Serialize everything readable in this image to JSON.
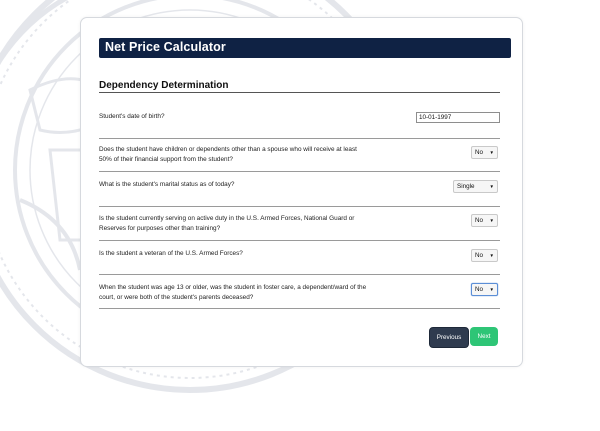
{
  "app": {
    "title": "Net Price Calculator"
  },
  "section": {
    "title": "Dependency Determination"
  },
  "questions": [
    {
      "text": "Student's date of birth?",
      "control": "text",
      "value": "10-01-1997"
    },
    {
      "text": "Does the student have children or dependents other than a spouse who will receive at least 50% of their financial support from the student?",
      "control": "select",
      "value": "No"
    },
    {
      "text": "What is the student's marital status as of today?",
      "control": "select",
      "value": "Single"
    },
    {
      "text": "Is the student currently serving on active duty in the U.S. Armed Forces, National Guard or Reserves for purposes other than training?",
      "control": "select",
      "value": "No"
    },
    {
      "text": "Is the student a veteran of the U.S. Armed Forces?",
      "control": "select",
      "value": "No"
    },
    {
      "text": "When the student was age 13 or older, was the student in foster care, a dependent/ward of the court, or were both of the student's parents deceased?",
      "control": "select",
      "value": "No"
    }
  ],
  "buttons": {
    "previous": "Previous",
    "next": "Next"
  },
  "icons": {
    "dropdown": "▼"
  },
  "colors": {
    "header": "#0f2244",
    "next_button": "#2ec576",
    "previous_button": "#2f3b4f"
  }
}
